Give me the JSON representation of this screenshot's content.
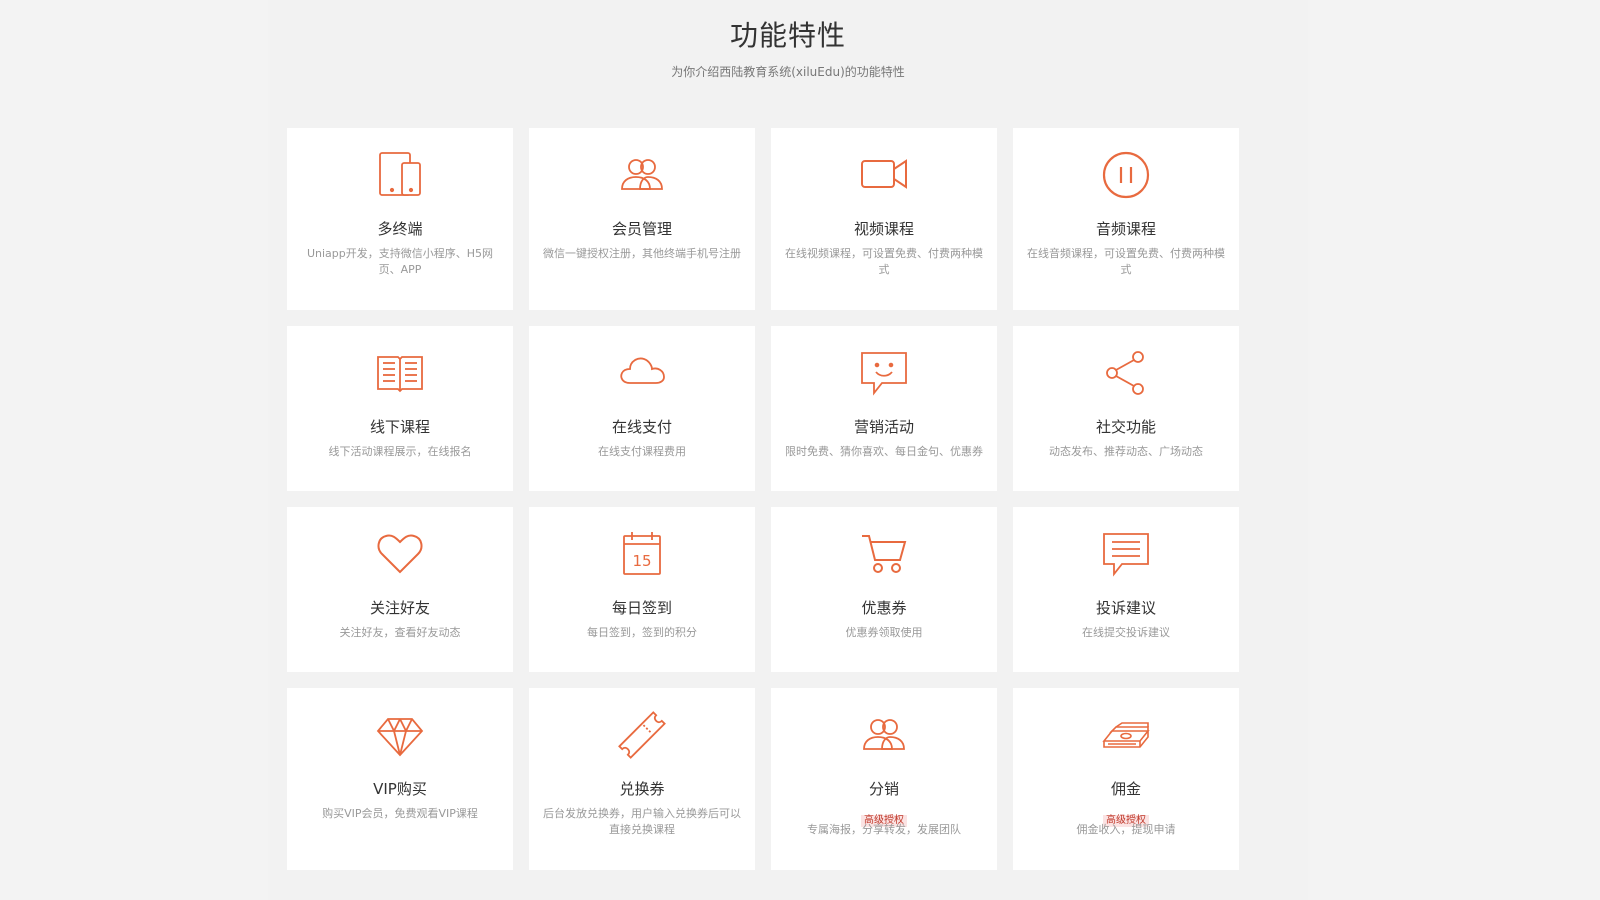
{
  "section": {
    "title": "功能特性",
    "subtitle": "为你介绍西陆教育系统(xiluEdu)的功能特性"
  },
  "accent_color": "#e86a3f",
  "features": [
    {
      "icon": "multi-device-icon",
      "name": "多终端",
      "desc": "Uniapp开发，支持微信小程序、H5网页、APP"
    },
    {
      "icon": "members-icon",
      "name": "会员管理",
      "desc": "微信一键授权注册，其他终端手机号注册"
    },
    {
      "icon": "video-camera-icon",
      "name": "视频课程",
      "desc": "在线视频课程，可设置免费、付费两种模式"
    },
    {
      "icon": "pause-circle-icon",
      "name": "音频课程",
      "desc": "在线音频课程，可设置免费、付费两种模式"
    },
    {
      "icon": "open-book-icon",
      "name": "线下课程",
      "desc": "线下活动课程展示，在线报名"
    },
    {
      "icon": "cloud-icon",
      "name": "在线支付",
      "desc": "在线支付课程费用"
    },
    {
      "icon": "smile-chat-icon",
      "name": "营销活动",
      "desc": "限时免费、猜你喜欢、每日金句、优惠券"
    },
    {
      "icon": "share-icon",
      "name": "社交功能",
      "desc": "动态发布、推荐动态、广场动态"
    },
    {
      "icon": "heart-icon",
      "name": "关注好友",
      "desc": "关注好友，查看好友动态"
    },
    {
      "icon": "calendar-icon",
      "name": "每日签到",
      "desc": "每日签到，签到的积分",
      "calendar_day": "15"
    },
    {
      "icon": "cart-icon",
      "name": "优惠券",
      "desc": "优惠券领取使用"
    },
    {
      "icon": "message-icon",
      "name": "投诉建议",
      "desc": "在线提交投诉建议"
    },
    {
      "icon": "diamond-icon",
      "name": "VIP购买",
      "desc": "购买VIP会员，免费观看VIP课程"
    },
    {
      "icon": "ticket-icon",
      "name": "兑换券",
      "desc": "后台发放兑换券，用户输入兑换券后可以直接兑换课程"
    },
    {
      "icon": "distribution-icon",
      "name": "分销",
      "tag": "高级授权",
      "desc": "专属海报，分享转发，发展团队"
    },
    {
      "icon": "money-stack-icon",
      "name": "佣金",
      "tag": "高级授权",
      "desc": "佣金收入，提现申请"
    }
  ]
}
